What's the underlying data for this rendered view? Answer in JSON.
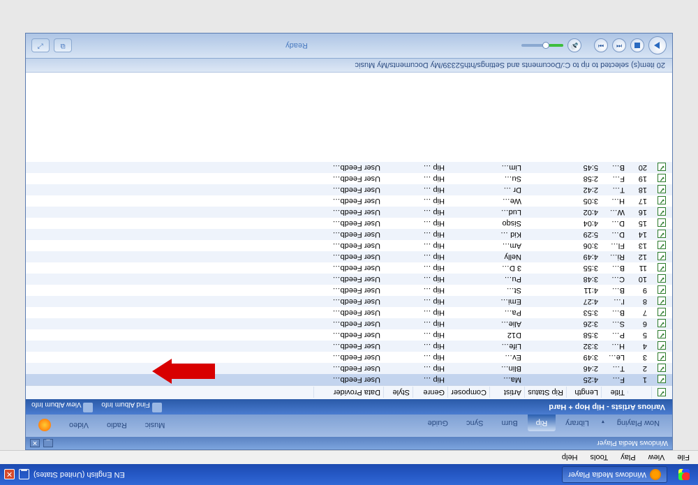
{
  "taskbar": {
    "task_title": "Windows Media Player",
    "lang": "EN English (United States)"
  },
  "menubar": [
    "File",
    "View",
    "Play",
    "Tools",
    "Help"
  ],
  "wmp": {
    "title": "Windows Media Player",
    "tabs": {
      "now_playing": "Now Playing",
      "library": "Library",
      "rip": "Rip",
      "burn": "Burn",
      "sync": "Sync",
      "guide": "Guide",
      "music": "Music",
      "radio": "Radio",
      "video": "Video"
    },
    "album_title": "Various Artists - Hip Hop + Hard",
    "find_album": "Find Album Info",
    "view_album": "View Album Info",
    "status_text": "20 item(s) selected to rip to C:/Documents and Settings/hth52339/My Documents/My Music",
    "ready": "Ready",
    "columns": {
      "title": "Title",
      "length": "Length",
      "rip_status": "Rip Status",
      "artist": "Artist",
      "composer": "Composer",
      "genre": "Genre",
      "style": "Style",
      "data_provider": "Data Provider"
    },
    "tracks": [
      {
        "n": 1,
        "title": "F…",
        "len": "4:25",
        "artist": "Ma…",
        "genre": "Hip …",
        "dp": "User Feedb…"
      },
      {
        "n": 2,
        "title": "T…",
        "len": "2:46",
        "artist": "Blin…",
        "genre": "Hip …",
        "dp": "User Feedb…"
      },
      {
        "n": 3,
        "title": "Le…",
        "len": "3:49",
        "artist": "Ev…",
        "genre": "Hip …",
        "dp": "User Feedb…"
      },
      {
        "n": 4,
        "title": "H…",
        "len": "3:32",
        "artist": "Life…",
        "genre": "Hip …",
        "dp": "User Feedb…"
      },
      {
        "n": 5,
        "title": "P…",
        "len": "3:58",
        "artist": "D12",
        "genre": "Hip …",
        "dp": "User Feedb…"
      },
      {
        "n": 6,
        "title": "S…",
        "len": "3:26",
        "artist": "Alie…",
        "genre": "Hip …",
        "dp": "User Feedb…"
      },
      {
        "n": 7,
        "title": "B…",
        "len": "3:53",
        "artist": "Pa…",
        "genre": "Hip …",
        "dp": "User Feedb…"
      },
      {
        "n": 8,
        "title": "I'…",
        "len": "4:27",
        "artist": "Emi…",
        "genre": "Hip …",
        "dp": "User Feedb…"
      },
      {
        "n": 9,
        "title": "B…",
        "len": "4:11",
        "artist": "St…",
        "genre": "Hip …",
        "dp": "User Feedb…"
      },
      {
        "n": 10,
        "title": "C…",
        "len": "3:48",
        "artist": "Pu…",
        "genre": "Hip …",
        "dp": "User Feedb…"
      },
      {
        "n": 11,
        "title": "B…",
        "len": "3:55",
        "artist": "3 D…",
        "genre": "Hip …",
        "dp": "User Feedb…"
      },
      {
        "n": 12,
        "title": "Ri…",
        "len": "4:49",
        "artist": "Nelly",
        "genre": "Hip …",
        "dp": "User Feedb…"
      },
      {
        "n": 13,
        "title": "Fl…",
        "len": "3:06",
        "artist": "Am…",
        "genre": "Hip …",
        "dp": "User Feedb…"
      },
      {
        "n": 14,
        "title": "D…",
        "len": "5:29",
        "artist": "Kid …",
        "genre": "Hip …",
        "dp": "User Feedb…"
      },
      {
        "n": 15,
        "title": "D…",
        "len": "4:04",
        "artist": "Sisqo",
        "genre": "Hip …",
        "dp": "User Feedb…"
      },
      {
        "n": 16,
        "title": "W…",
        "len": "4:02",
        "artist": "Lud…",
        "genre": "Hip …",
        "dp": "User Feedb…"
      },
      {
        "n": 17,
        "title": "H…",
        "len": "3:05",
        "artist": "We…",
        "genre": "Hip …",
        "dp": "User Feedb…"
      },
      {
        "n": 18,
        "title": "T…",
        "len": "2:42",
        "artist": "Dr …",
        "genre": "Hip …",
        "dp": "User Feedb…"
      },
      {
        "n": 19,
        "title": "F…",
        "len": "2:58",
        "artist": "Su…",
        "genre": "Hip …",
        "dp": "User Feedb…"
      },
      {
        "n": 20,
        "title": "B…",
        "len": "5:45",
        "artist": "Lim…",
        "genre": "Hip …",
        "dp": "User Feedb…"
      }
    ]
  }
}
